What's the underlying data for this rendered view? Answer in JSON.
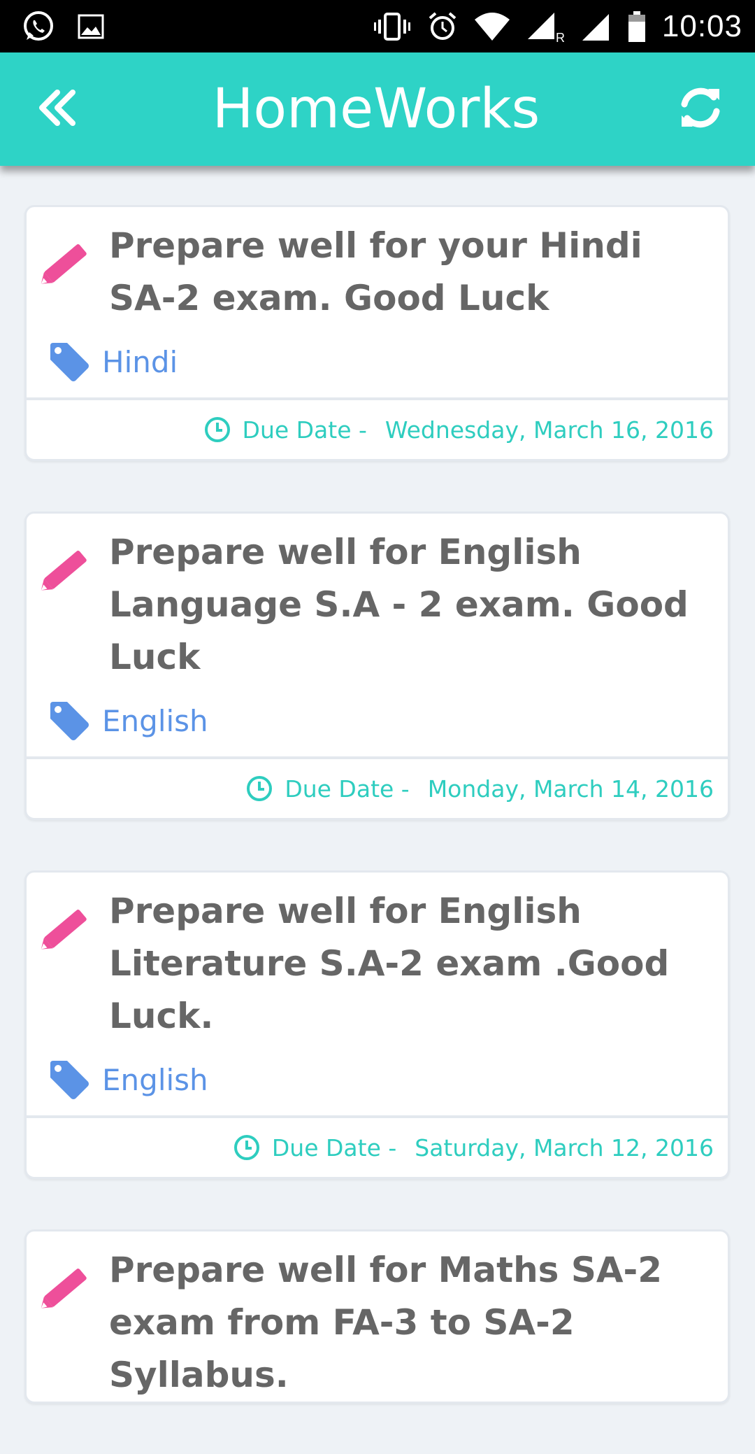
{
  "status_bar": {
    "time": "10:03",
    "left_icons": [
      "whatsapp-icon",
      "image-icon"
    ],
    "right_icons": [
      "vibrate-icon",
      "alarm-icon",
      "wifi-icon",
      "signal-roaming-icon",
      "signal-icon",
      "battery-icon"
    ]
  },
  "app_bar": {
    "title": "HomeWorks",
    "back_icon": "double-chevron-left-icon",
    "refresh_icon": "refresh-icon"
  },
  "colors": {
    "accent": "#2ed3c6",
    "pencil": "#ee4f9a",
    "tag": "#5b93e6",
    "due": "#2ecdbf",
    "title_text": "#666666"
  },
  "homeworks": [
    {
      "text": "Prepare well for your Hindi SA-2 exam. Good Luck",
      "subject": "Hindi",
      "due_label": "Due Date -",
      "due_date": "Wednesday, March 16, 2016"
    },
    {
      "text": "Prepare well for English Language S.A - 2 exam. Good Luck",
      "subject": "English",
      "due_label": "Due Date -",
      "due_date": "Monday, March 14, 2016"
    },
    {
      "text": "Prepare well for English Literature S.A-2 exam .Good Luck.",
      "subject": "English",
      "due_label": "Due Date -",
      "due_date": "Saturday, March 12, 2016"
    },
    {
      "text": "Prepare well for Maths SA-2 exam from FA-3 to SA-2 Syllabus.",
      "subject": "",
      "due_label": "",
      "due_date": ""
    }
  ]
}
